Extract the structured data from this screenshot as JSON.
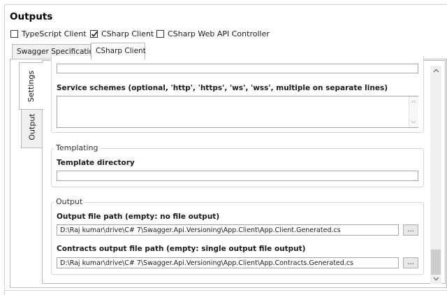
{
  "section_title": "Outputs",
  "output_checkboxes": [
    {
      "label": "TypeScript Client",
      "checked": false
    },
    {
      "label": "CSharp Client",
      "checked": true
    },
    {
      "label": "CSharp Web API Controller",
      "checked": false
    }
  ],
  "top_tabs": [
    {
      "label": "Swagger Specification",
      "selected": false
    },
    {
      "label": "CSharp Client",
      "selected": true
    }
  ],
  "side_tabs": [
    {
      "label": "Settings",
      "selected": true
    },
    {
      "label": "Output",
      "selected": false
    }
  ],
  "service_schemes": {
    "label": "Service schemes (optional, 'http', 'https', 'ws', 'wss', multiple on separate lines)",
    "value": ""
  },
  "templating": {
    "caption": "Templating",
    "template_directory_label": "Template directory",
    "template_directory_value": ""
  },
  "output_group": {
    "caption": "Output",
    "output_file_label": "Output file path (empty: no file output)",
    "output_file_value": "D:\\Raj kumar\\drive\\C# 7\\Swagger.Api.Versioning\\App.Client\\App.Client.Generated.cs",
    "contracts_file_label": "Contracts output file path (empty: single output file output)",
    "contracts_file_value": "D:\\Raj kumar\\drive\\C# 7\\Swagger.Api.Versioning\\App.Client\\App.Contracts.Generated.cs",
    "browse_label": "..."
  },
  "colors": {
    "border": "#b9b9b9",
    "tab_background": "#f0f0f0",
    "scrollbar_track": "#f0f0f0",
    "scrollbar_thumb": "#cdcdcd"
  },
  "icons": {
    "checkmark": "checkmark-icon",
    "scroll_up": "chevron-up-icon",
    "scroll_down": "chevron-down-icon"
  }
}
